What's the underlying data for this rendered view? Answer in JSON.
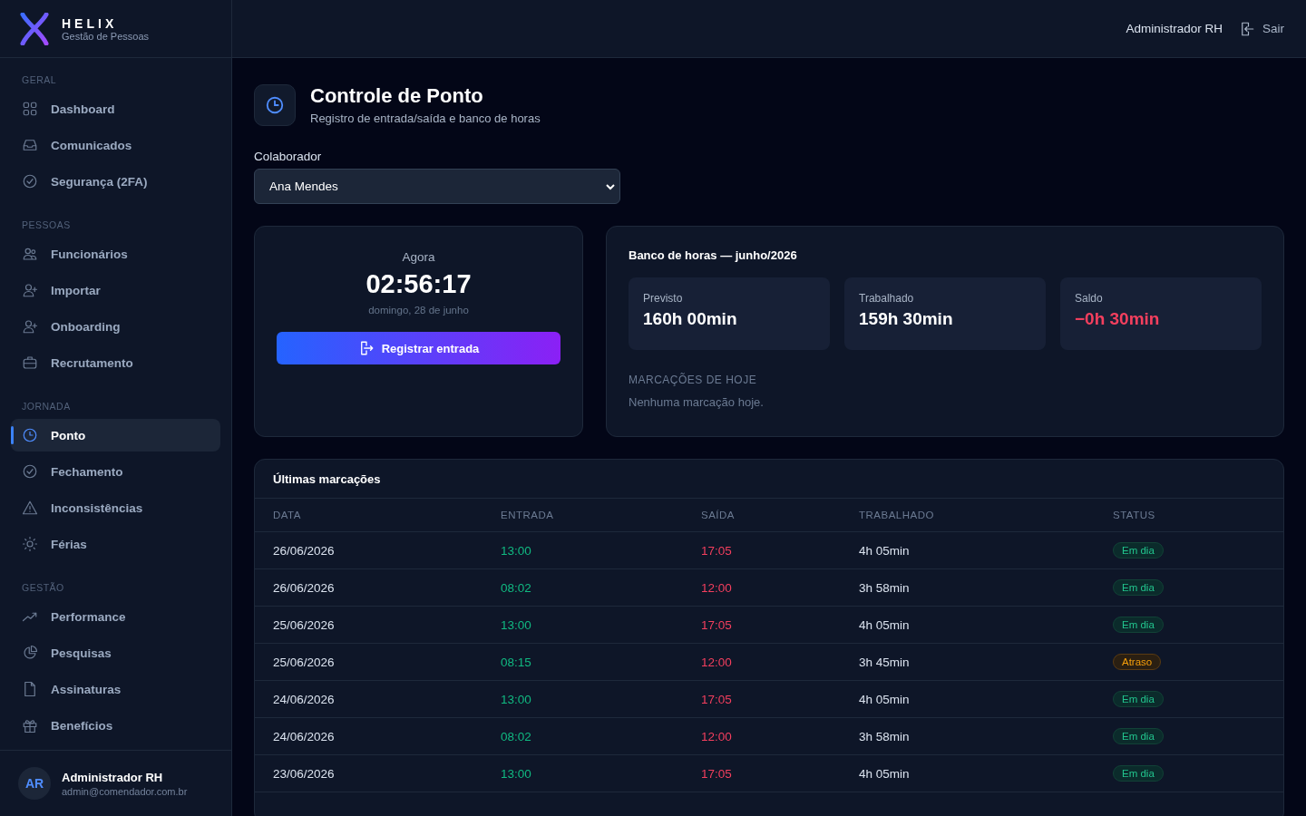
{
  "brand": {
    "name": "HELIX",
    "tagline": "Gestão de Pessoas"
  },
  "topbar": {
    "user": "Administrador RH",
    "logout": "Sair"
  },
  "sidebar": {
    "sections": [
      {
        "label": "GERAL",
        "items": [
          {
            "label": "Dashboard",
            "kind": "grid",
            "selected": false
          },
          {
            "label": "Comunicados",
            "kind": "inbox",
            "selected": false
          },
          {
            "label": "Segurança (2FA)",
            "kind": "check",
            "selected": false
          }
        ]
      },
      {
        "label": "PESSOAS",
        "items": [
          {
            "label": "Funcionários",
            "kind": "users",
            "selected": false
          },
          {
            "label": "Importar",
            "kind": "useradd",
            "selected": false
          },
          {
            "label": "Onboarding",
            "kind": "useradd",
            "selected": false
          },
          {
            "label": "Recrutamento",
            "kind": "briefcase",
            "selected": false
          }
        ]
      },
      {
        "label": "JORNADA",
        "items": [
          {
            "label": "Ponto",
            "kind": "clock",
            "selected": true
          },
          {
            "label": "Fechamento",
            "kind": "check",
            "selected": false
          },
          {
            "label": "Inconsistências",
            "kind": "warning",
            "selected": false
          },
          {
            "label": "Férias",
            "kind": "sun",
            "selected": false
          }
        ]
      },
      {
        "label": "GESTÃO",
        "items": [
          {
            "label": "Performance",
            "kind": "trend",
            "selected": false
          },
          {
            "label": "Pesquisas",
            "kind": "pie",
            "selected": false
          },
          {
            "label": "Assinaturas",
            "kind": "file",
            "selected": false
          },
          {
            "label": "Benefícios",
            "kind": "gift",
            "selected": false
          }
        ]
      }
    ],
    "user": {
      "initials": "AR",
      "name": "Administrador RH",
      "email": "admin@comendador.com.br"
    }
  },
  "page": {
    "title": "Controle de Ponto",
    "subtitle": "Registro de entrada/saída e banco de horas"
  },
  "collaborator": {
    "label": "Colaborador",
    "value": "Ana Mendes"
  },
  "clock": {
    "label": "Agora",
    "time": "02:56:17",
    "date": "domingo, 28 de junho",
    "button": "Registrar entrada"
  },
  "bank": {
    "title": "Banco de horas — junho/2026",
    "stats": [
      {
        "label": "Previsto",
        "value": "160h 00min",
        "kind": "neutral"
      },
      {
        "label": "Trabalhado",
        "value": "159h 30min",
        "kind": "neutral"
      },
      {
        "label": "Saldo",
        "value": "−0h 30min",
        "kind": "negative"
      }
    ],
    "today_label": "MARCAÇÕES DE HOJE",
    "today_empty": "Nenhuma marcação hoje."
  },
  "table": {
    "title": "Últimas marcações",
    "columns": [
      "DATA",
      "ENTRADA",
      "SAÍDA",
      "TRABALHADO",
      "STATUS"
    ],
    "rows": [
      {
        "date": "26/06/2026",
        "in": "13:00",
        "out": "17:05",
        "worked": "4h 05min",
        "status": "Em dia",
        "kind": "ok"
      },
      {
        "date": "26/06/2026",
        "in": "08:02",
        "out": "12:00",
        "worked": "3h 58min",
        "status": "Em dia",
        "kind": "ok"
      },
      {
        "date": "25/06/2026",
        "in": "13:00",
        "out": "17:05",
        "worked": "4h 05min",
        "status": "Em dia",
        "kind": "ok"
      },
      {
        "date": "25/06/2026",
        "in": "08:15",
        "out": "12:00",
        "worked": "3h 45min",
        "status": "Atraso",
        "kind": "late"
      },
      {
        "date": "24/06/2026",
        "in": "13:00",
        "out": "17:05",
        "worked": "4h 05min",
        "status": "Em dia",
        "kind": "ok"
      },
      {
        "date": "24/06/2026",
        "in": "08:02",
        "out": "12:00",
        "worked": "3h 58min",
        "status": "Em dia",
        "kind": "ok"
      },
      {
        "date": "23/06/2026",
        "in": "13:00",
        "out": "17:05",
        "worked": "4h 05min",
        "status": "Em dia",
        "kind": "ok"
      }
    ]
  }
}
